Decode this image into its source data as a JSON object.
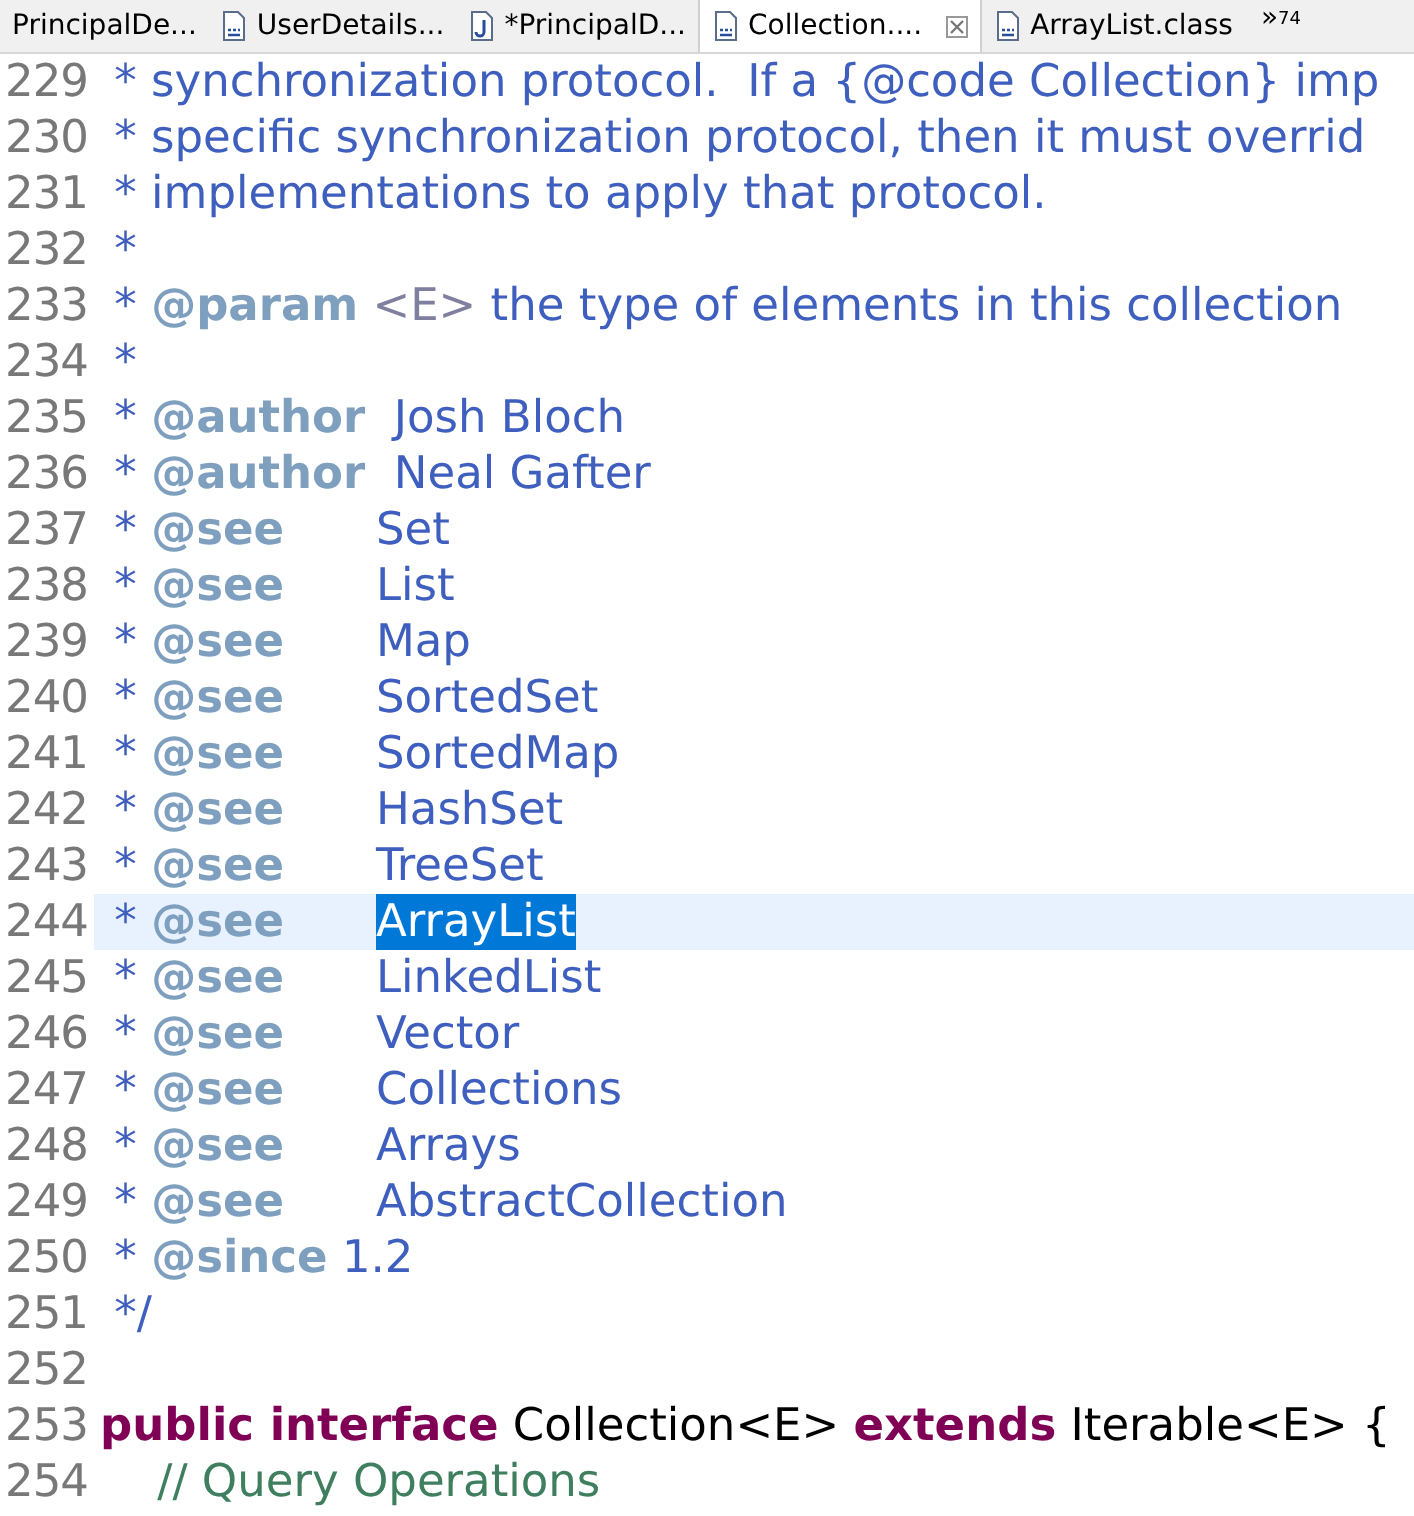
{
  "tabs": [
    {
      "label": "PrincipalDe...",
      "kind": "plain",
      "selected": false,
      "closable": false
    },
    {
      "label": "UserDetails...",
      "kind": "class",
      "selected": false,
      "closable": false
    },
    {
      "label": "*PrincipalD...",
      "kind": "java",
      "selected": false,
      "closable": false
    },
    {
      "label": "Collection....",
      "kind": "class",
      "selected": true,
      "closable": true
    },
    {
      "label": "ArrayList.class",
      "kind": "class",
      "selected": false,
      "closable": false
    }
  ],
  "overflow": {
    "symbol": "»",
    "count": "74"
  },
  "lines": [
    {
      "number": "229",
      "current": false,
      "segments": [
        {
          "kind": "doc",
          "text": " * synchronization protocol.  If a {@code Collection} imp",
          "selected": false
        }
      ]
    },
    {
      "number": "230",
      "current": false,
      "segments": [
        {
          "kind": "doc",
          "text": " * specific synchronization protocol, then it must overrid",
          "selected": false
        }
      ]
    },
    {
      "number": "231",
      "current": false,
      "segments": [
        {
          "kind": "doc",
          "text": " * implementations to apply that protocol.",
          "selected": false
        }
      ]
    },
    {
      "number": "232",
      "current": false,
      "segments": [
        {
          "kind": "doc",
          "text": " *",
          "selected": false
        }
      ]
    },
    {
      "number": "233",
      "current": false,
      "segments": [
        {
          "kind": "doc",
          "text": " * ",
          "selected": false
        },
        {
          "kind": "tag",
          "text": "@param",
          "selected": false
        },
        {
          "kind": "html",
          "text": " <E>",
          "selected": false
        },
        {
          "kind": "doc",
          "text": " the type of elements in this collection",
          "selected": false
        }
      ]
    },
    {
      "number": "234",
      "current": false,
      "segments": [
        {
          "kind": "doc",
          "text": " *",
          "selected": false
        }
      ]
    },
    {
      "number": "235",
      "current": false,
      "segments": [
        {
          "kind": "doc",
          "text": " * ",
          "selected": false
        },
        {
          "kind": "tag",
          "text": "@author",
          "selected": false
        },
        {
          "kind": "doc",
          "text": "  Josh Bloch",
          "selected": false
        }
      ]
    },
    {
      "number": "236",
      "current": false,
      "segments": [
        {
          "kind": "doc",
          "text": " * ",
          "selected": false
        },
        {
          "kind": "tag",
          "text": "@author",
          "selected": false
        },
        {
          "kind": "doc",
          "text": "  Neal Gafter",
          "selected": false
        }
      ]
    },
    {
      "number": "237",
      "current": false,
      "segments": [
        {
          "kind": "doc",
          "text": " * ",
          "selected": false
        },
        {
          "kind": "tag",
          "text": "@see",
          "selected": false
        },
        {
          "kind": "ref",
          "text": "Set",
          "selected": false
        }
      ]
    },
    {
      "number": "238",
      "current": false,
      "segments": [
        {
          "kind": "doc",
          "text": " * ",
          "selected": false
        },
        {
          "kind": "tag",
          "text": "@see",
          "selected": false
        },
        {
          "kind": "ref",
          "text": "List",
          "selected": false
        }
      ]
    },
    {
      "number": "239",
      "current": false,
      "segments": [
        {
          "kind": "doc",
          "text": " * ",
          "selected": false
        },
        {
          "kind": "tag",
          "text": "@see",
          "selected": false
        },
        {
          "kind": "ref",
          "text": "Map",
          "selected": false
        }
      ]
    },
    {
      "number": "240",
      "current": false,
      "segments": [
        {
          "kind": "doc",
          "text": " * ",
          "selected": false
        },
        {
          "kind": "tag",
          "text": "@see",
          "selected": false
        },
        {
          "kind": "ref",
          "text": "SortedSet",
          "selected": false
        }
      ]
    },
    {
      "number": "241",
      "current": false,
      "segments": [
        {
          "kind": "doc",
          "text": " * ",
          "selected": false
        },
        {
          "kind": "tag",
          "text": "@see",
          "selected": false
        },
        {
          "kind": "ref",
          "text": "SortedMap",
          "selected": false
        }
      ]
    },
    {
      "number": "242",
      "current": false,
      "segments": [
        {
          "kind": "doc",
          "text": " * ",
          "selected": false
        },
        {
          "kind": "tag",
          "text": "@see",
          "selected": false
        },
        {
          "kind": "ref",
          "text": "HashSet",
          "selected": false
        }
      ]
    },
    {
      "number": "243",
      "current": false,
      "segments": [
        {
          "kind": "doc",
          "text": " * ",
          "selected": false
        },
        {
          "kind": "tag",
          "text": "@see",
          "selected": false
        },
        {
          "kind": "ref",
          "text": "TreeSet",
          "selected": false
        }
      ]
    },
    {
      "number": "244",
      "current": true,
      "segments": [
        {
          "kind": "doc",
          "text": " * ",
          "selected": false
        },
        {
          "kind": "tag",
          "text": "@see",
          "selected": false
        },
        {
          "kind": "ref",
          "text": "ArrayList",
          "selected": true
        }
      ]
    },
    {
      "number": "245",
      "current": false,
      "segments": [
        {
          "kind": "doc",
          "text": " * ",
          "selected": false
        },
        {
          "kind": "tag",
          "text": "@see",
          "selected": false
        },
        {
          "kind": "ref",
          "text": "LinkedList",
          "selected": false
        }
      ]
    },
    {
      "number": "246",
      "current": false,
      "segments": [
        {
          "kind": "doc",
          "text": " * ",
          "selected": false
        },
        {
          "kind": "tag",
          "text": "@see",
          "selected": false
        },
        {
          "kind": "ref",
          "text": "Vector",
          "selected": false
        }
      ]
    },
    {
      "number": "247",
      "current": false,
      "segments": [
        {
          "kind": "doc",
          "text": " * ",
          "selected": false
        },
        {
          "kind": "tag",
          "text": "@see",
          "selected": false
        },
        {
          "kind": "ref",
          "text": "Collections",
          "selected": false
        }
      ]
    },
    {
      "number": "248",
      "current": false,
      "segments": [
        {
          "kind": "doc",
          "text": " * ",
          "selected": false
        },
        {
          "kind": "tag",
          "text": "@see",
          "selected": false
        },
        {
          "kind": "ref",
          "text": "Arrays",
          "selected": false
        }
      ]
    },
    {
      "number": "249",
      "current": false,
      "segments": [
        {
          "kind": "doc",
          "text": " * ",
          "selected": false
        },
        {
          "kind": "tag",
          "text": "@see",
          "selected": false
        },
        {
          "kind": "ref",
          "text": "AbstractCollection",
          "selected": false
        }
      ]
    },
    {
      "number": "250",
      "current": false,
      "segments": [
        {
          "kind": "doc",
          "text": " * ",
          "selected": false
        },
        {
          "kind": "tag",
          "text": "@since",
          "selected": false
        },
        {
          "kind": "doc",
          "text": " 1.2",
          "selected": false
        }
      ]
    },
    {
      "number": "251",
      "current": false,
      "segments": [
        {
          "kind": "doc",
          "text": " */",
          "selected": false
        }
      ]
    },
    {
      "number": "252",
      "current": false
    },
    {
      "number": "253",
      "current": false,
      "segments": [
        {
          "kind": "keyword",
          "text": "public interface",
          "selected": false
        },
        {
          "kind": "plain",
          "text": " Collection<E> ",
          "selected": false
        },
        {
          "kind": "keyword",
          "text": "extends",
          "selected": false
        },
        {
          "kind": "plain",
          "text": " Iterable<E> {",
          "selected": false
        }
      ]
    },
    {
      "number": "254",
      "current": false,
      "segments": [
        {
          "kind": "comment",
          "text": "    // Query Operations",
          "selected": false
        }
      ]
    }
  ]
}
